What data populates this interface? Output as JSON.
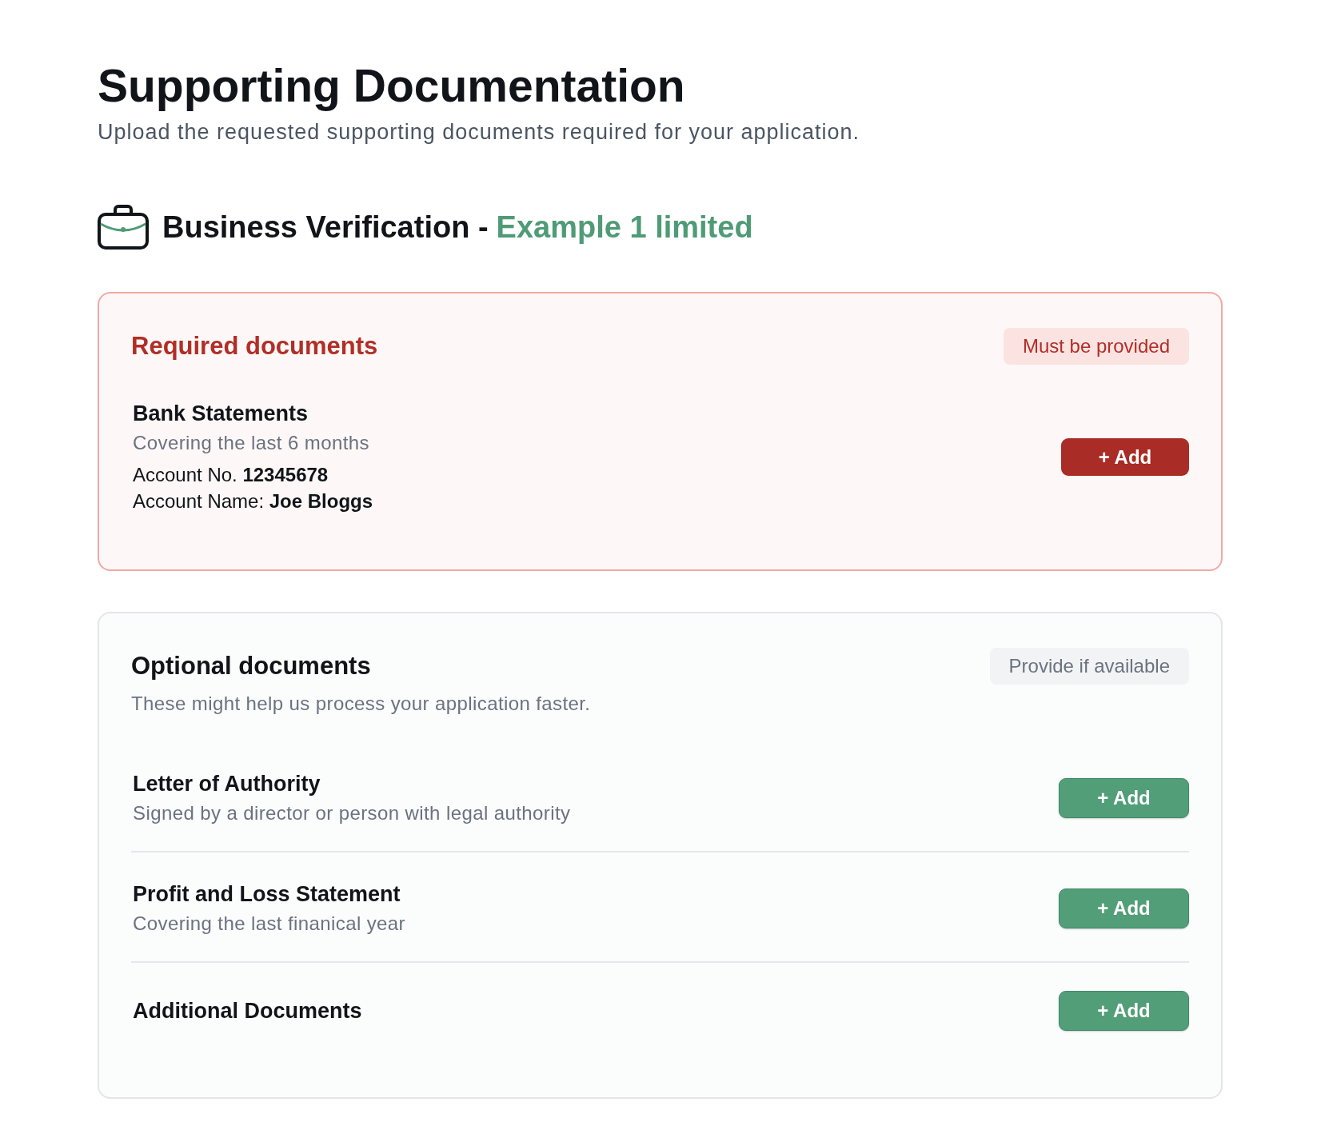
{
  "page": {
    "title": "Supporting Documentation",
    "subtitle": "Upload the requested supporting documents required for your application."
  },
  "section": {
    "title": "Business Verification -",
    "company": "Example 1 limited"
  },
  "groups": [
    {
      "kind": "required",
      "title": "Required documents",
      "badge": "Must be provided",
      "documents": [
        {
          "name": "Bank Statements",
          "description": "Covering the last 6 months",
          "details": [
            "Account No. **12345678**",
            "Account Name: **Joe Bloggs**"
          ],
          "action": "+ Add"
        }
      ]
    },
    {
      "kind": "optional",
      "title": "Optional documents",
      "badge": "Provide if available",
      "description": "These might help us process your application faster.",
      "documents": [
        {
          "name": "Letter of Authority",
          "description": "Signed by a director or person with legal authority",
          "action": "+ Add"
        },
        {
          "name": "Profit and Loss Statement",
          "description": "Covering the last finanical year",
          "action": "+ Add"
        },
        {
          "name": "Additional Documents",
          "action": "+ Add"
        }
      ]
    }
  ]
}
